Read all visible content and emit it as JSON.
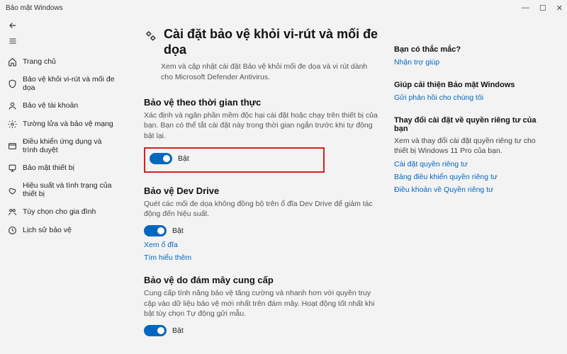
{
  "window": {
    "title": "Bảo mật Windows",
    "minimize": "—",
    "maximize": "☐",
    "close": "✕"
  },
  "sidebar": {
    "items": [
      {
        "label": "Trang chủ",
        "icon": "home"
      },
      {
        "label": "Bảo vệ khỏi vi-rút và mối đe dọa",
        "icon": "shield"
      },
      {
        "label": "Bảo vệ tài khoản",
        "icon": "account"
      },
      {
        "label": "Tường lửa và bảo vệ mạng",
        "icon": "firewall"
      },
      {
        "label": "Điều khiển ứng dụng và trình duyệt",
        "icon": "app"
      },
      {
        "label": "Bảo mật thiết bị",
        "icon": "device"
      },
      {
        "label": "Hiệu suất và tình trạng của thiết bị",
        "icon": "health"
      },
      {
        "label": "Tùy chọn cho gia đình",
        "icon": "family"
      },
      {
        "label": "Lịch sử bảo vệ",
        "icon": "history"
      }
    ]
  },
  "page": {
    "title": "Cài đặt bảo vệ khỏi vi-rút và mối đe dọa",
    "subtitle": "Xem và cập nhật cài đặt Bảo vệ khỏi mối đe dọa và vi rút dành cho Microsoft Defender Antivirus."
  },
  "sections": {
    "realtime": {
      "title": "Bảo vệ theo thời gian thực",
      "desc": "Xác định và ngăn phần mềm độc hại cài đặt hoặc chạy trên thiết bị của bạn. Bạn có thể tắt cài đặt này trong thời gian ngắn trước khi tự động bật lại.",
      "toggle": "Bật"
    },
    "devdrive": {
      "title": "Bảo vệ Dev Drive",
      "desc": "Quét các mối đe dọa không đồng bộ trên ổ đĩa Dev Drive để giảm tác động đến hiệu suất.",
      "toggle": "Bật",
      "link1": "Xem ổ đĩa",
      "link2": "Tìm hiểu thêm"
    },
    "cloud": {
      "title": "Bảo vệ do đám mây cung cấp",
      "desc": "Cung cấp tính năng bảo vệ tăng cường và nhanh hơn với quyền truy cập vào dữ liệu bảo vệ mới nhất trên đám mây. Hoạt động tốt nhất khi bật tùy chọn Tự động gửi mẫu.",
      "toggle": "Bật"
    }
  },
  "right": {
    "q": {
      "title": "Bạn có thắc mắc?",
      "link": "Nhận trợ giúp"
    },
    "improve": {
      "title": "Giúp cải thiện Bảo mật Windows",
      "link": "Gửi phản hồi cho chúng tôi"
    },
    "privacy": {
      "title": "Thay đổi cài đặt về quyền riêng tư của bạn",
      "desc": "Xem và thay đổi cài đặt quyền riêng tư cho thiết bị Windows 11 Pro của bạn.",
      "link1": "Cài đặt quyền riêng tư",
      "link2": "Bảng điều khiển quyền riêng tư",
      "link3": "Điều khoản về Quyền riêng tư"
    }
  }
}
